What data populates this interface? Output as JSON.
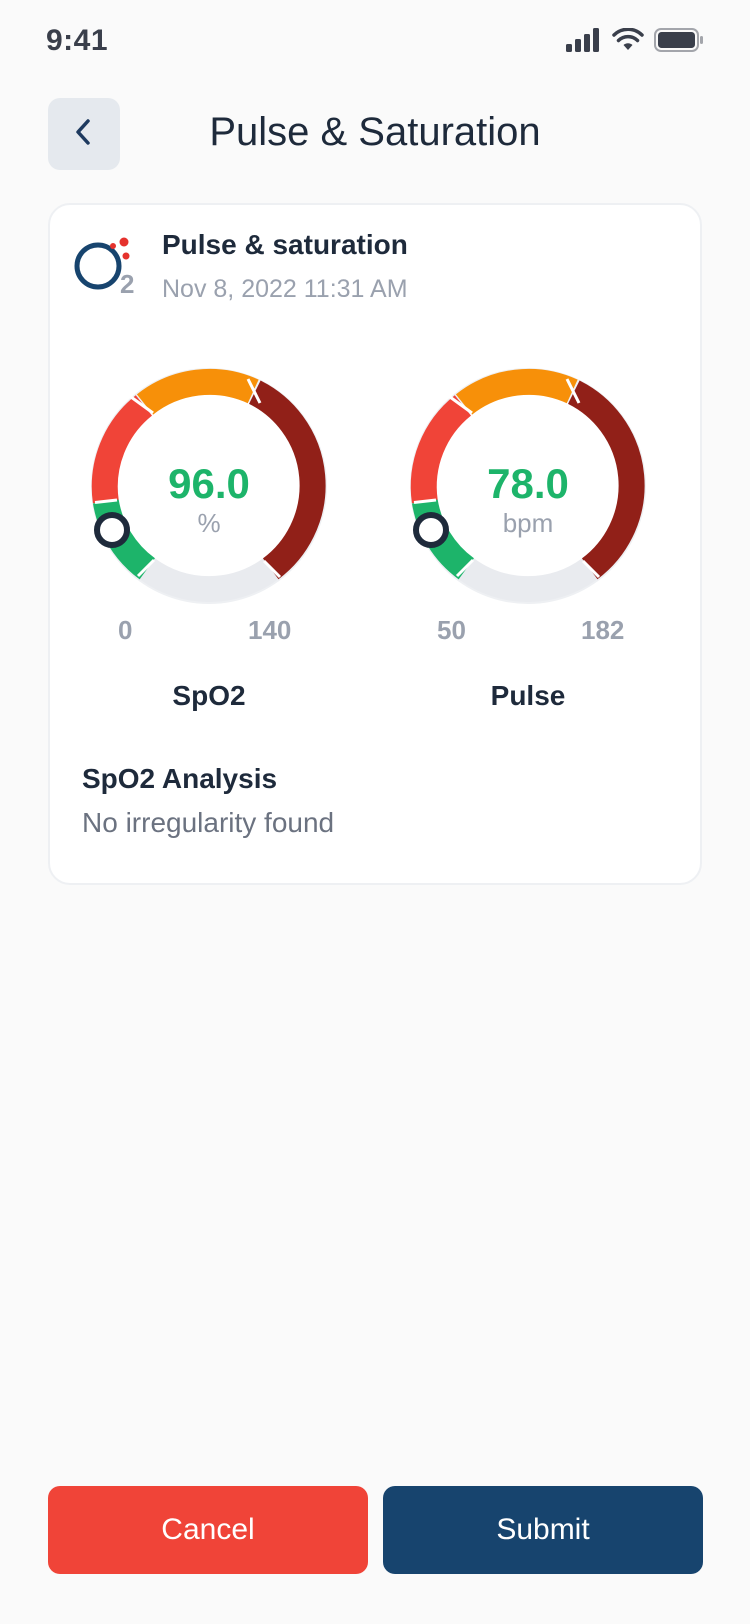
{
  "status_bar": {
    "time": "9:41",
    "icons": [
      "cellular-signal-icon",
      "wifi-icon",
      "battery-icon"
    ]
  },
  "header": {
    "title": "Pulse & Saturation",
    "back_icon": "chevron-left-icon"
  },
  "card": {
    "title": "Pulse & saturation",
    "date": "Nov 8, 2022 11:31 AM",
    "logo": {
      "icon": "o2-icon",
      "subscript": "2"
    },
    "gauges": [
      {
        "label": "SpO2",
        "value": "96.0",
        "unit": "%",
        "min": "0",
        "max": "140"
      },
      {
        "label": "Pulse",
        "value": "78.0",
        "unit": "bpm",
        "min": "50",
        "max": "182"
      }
    ],
    "analysis": {
      "title": "SpO2 Analysis",
      "text": "No irregularity found"
    }
  },
  "actions": {
    "cancel_label": "Cancel",
    "submit_label": "Submit"
  },
  "colors": {
    "green": "#1DB46A",
    "red": "#F04438",
    "orange": "#F79009",
    "dark_red": "#912018",
    "track": "#E9EBEF",
    "navy": "#17446E",
    "background": "#FAFAFA"
  }
}
